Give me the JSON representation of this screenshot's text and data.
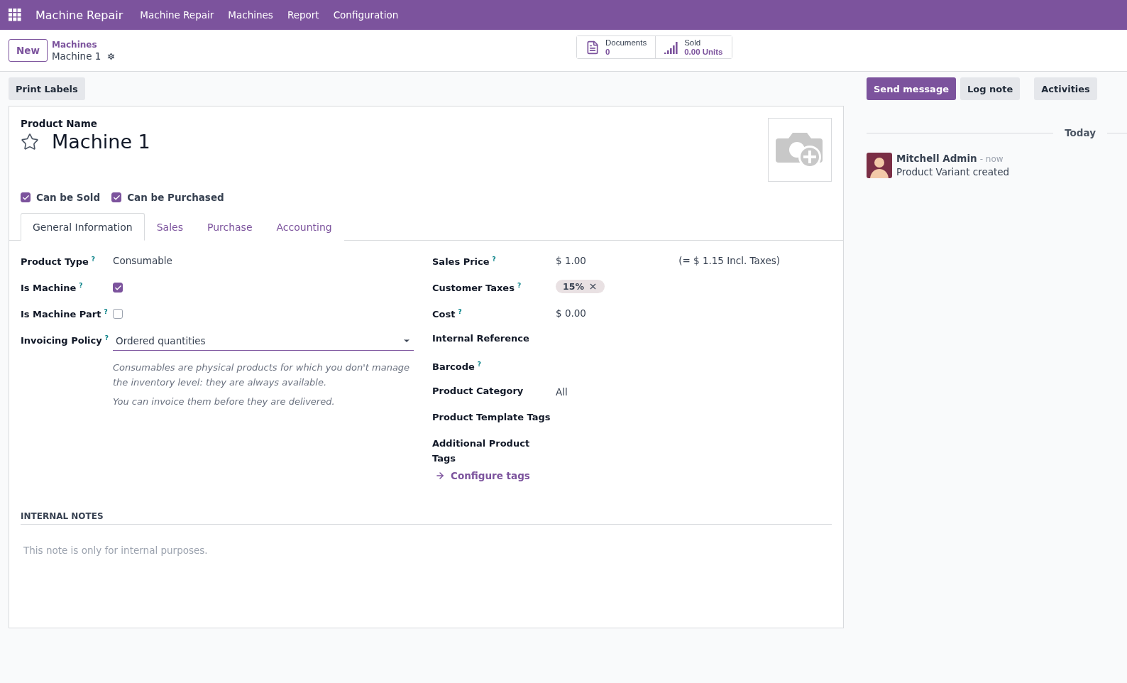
{
  "navbar": {
    "app_name": "Machine Repair",
    "menus": [
      "Machine Repair",
      "Machines",
      "Report",
      "Configuration"
    ]
  },
  "control_panel": {
    "new_button": "New",
    "breadcrumb": {
      "parent": "Machines",
      "current": "Machine 1"
    },
    "smart_buttons": [
      {
        "kind": "documents",
        "label": "Documents",
        "value": "0"
      },
      {
        "kind": "sold",
        "label": "Sold",
        "value": "0.00 Units"
      }
    ]
  },
  "action_buttons": [
    "Print Labels"
  ],
  "form": {
    "name_label": "Product Name",
    "name": "Machine 1",
    "favorite": false,
    "options": [
      {
        "label": "Can be Sold",
        "checked": true
      },
      {
        "label": "Can be Purchased",
        "checked": true
      }
    ],
    "tabs": [
      {
        "label": "General Information",
        "selected": true
      },
      {
        "label": "Sales",
        "selected": false
      },
      {
        "label": "Purchase",
        "selected": false
      },
      {
        "label": "Accounting",
        "selected": false
      }
    ],
    "left_fields": [
      {
        "kind": "text",
        "label": "Product Type",
        "help": "?",
        "value": "Consumable"
      },
      {
        "kind": "checkbox",
        "label": "Is Machine",
        "help": "?",
        "checked": true
      },
      {
        "kind": "checkbox",
        "label": "Is Machine Part",
        "help": "?",
        "checked": false
      },
      {
        "kind": "select",
        "label": "Invoicing Policy",
        "help": "?",
        "value": "Ordered quantities"
      }
    ],
    "notes": [
      "Consumables are physical products for which you don't manage the inventory level: they are always available.",
      "You can invoice them before they are delivered."
    ],
    "right_fields": [
      {
        "kind": "text",
        "label": "Sales Price",
        "help": "?",
        "value": "$ 1.00",
        "extra": "(= $ 1.15 Incl. Taxes)"
      },
      {
        "kind": "tags",
        "label": "Customer Taxes",
        "help": "?",
        "tags": [
          "15%"
        ]
      },
      {
        "kind": "text",
        "label": "Cost",
        "help": "?",
        "value": "$ 0.00"
      },
      {
        "kind": "empty",
        "label": "Internal Reference"
      },
      {
        "kind": "empty",
        "label": "Barcode",
        "help": "?"
      },
      {
        "kind": "text",
        "label": "Product Category",
        "value": "All"
      },
      {
        "kind": "empty",
        "label": "Product Template Tags"
      },
      {
        "kind": "empty",
        "label": "Additional Product Tags"
      }
    ],
    "configure_link": "Configure tags",
    "internal_notes": {
      "heading": "INTERNAL NOTES",
      "placeholder": "This note is only for internal purposes."
    }
  },
  "chatter": {
    "buttons": [
      {
        "label": "Send message",
        "primary": true
      },
      {
        "label": "Log note",
        "primary": false
      },
      {
        "label": "Activities",
        "primary": false
      }
    ],
    "date_separator": "Today",
    "messages": [
      {
        "author": "Mitchell Admin",
        "time": "- now",
        "body": "Product Variant created"
      }
    ]
  }
}
